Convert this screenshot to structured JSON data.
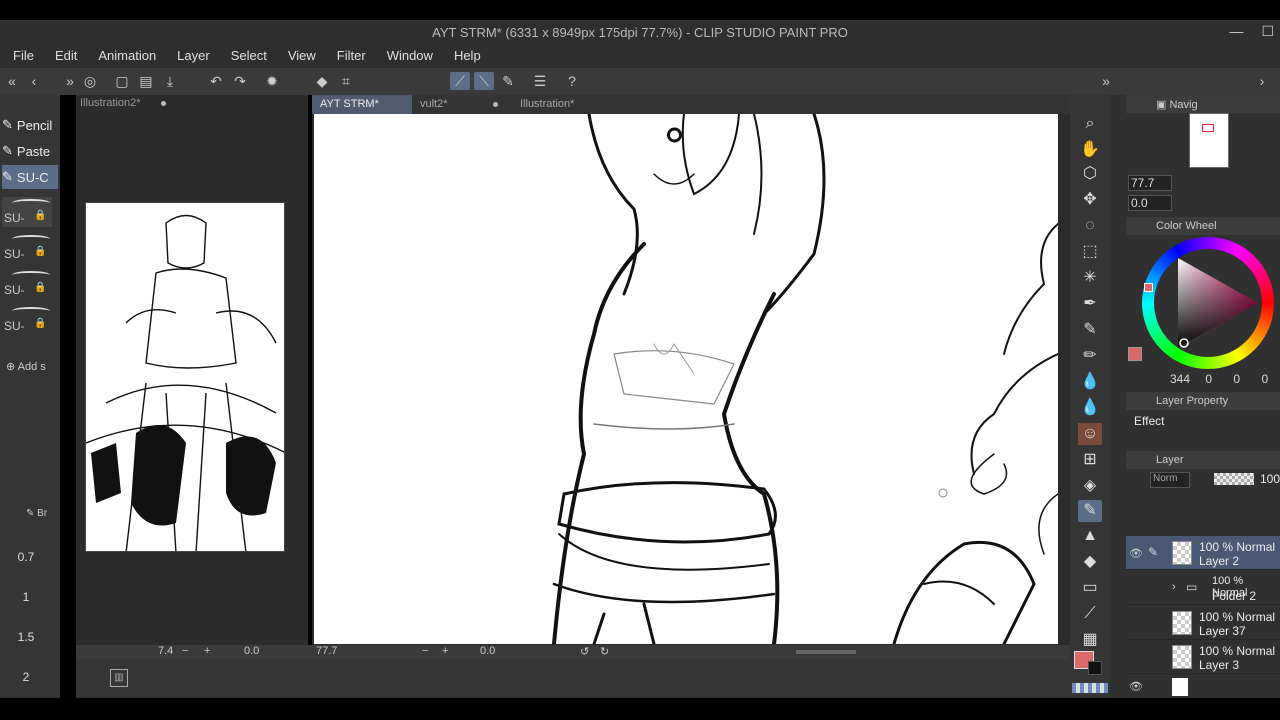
{
  "window": {
    "title": "AYT STRM* (6331 x 8949px 175dpi 77.7%) - CLIP STUDIO PAINT PRO",
    "minimize": "—",
    "maximize": "☐",
    "close": "✕"
  },
  "menu": [
    "File",
    "Edit",
    "Animation",
    "Layer",
    "Select",
    "View",
    "Filter",
    "Window",
    "Help"
  ],
  "subtools": [
    "Pencil",
    "Paste",
    "SU-C"
  ],
  "brushes": [
    "SU-",
    "SU-",
    "SU-",
    "SU-"
  ],
  "add_subtool": "Add s",
  "brush_size_label": "Br",
  "brush_sizes": [
    "0.7",
    "1",
    "1.5",
    "2"
  ],
  "nav_tab": "Illustration2*",
  "doc_tabs": [
    "AYT STRM*",
    "vult2*",
    "Illustration*"
  ],
  "status": {
    "nav_zoom": "7.4",
    "nav_rot": "0.0",
    "canvas_zoom": "77.7",
    "canvas_rot": "0.0"
  },
  "right": {
    "navigator_label": "Navig",
    "zoom": "77.7",
    "rotation": "0.0",
    "color_wheel_label": "Color Wheel",
    "color_value": "344",
    "color_s": "0",
    "color_v": "0",
    "color_extra": "0",
    "layer_property_label": "Layer Property",
    "effect_label": "Effect",
    "layer_label": "Layer",
    "blend_mode": "Norm",
    "opacity": "100",
    "main_color": "#d96a6a",
    "sub_color": "#111111"
  },
  "layers": [
    {
      "mode": "100 % Normal",
      "name": "Layer 2",
      "active": true
    },
    {
      "mode": "100 % Normal",
      "name": "Folder 2",
      "active": false
    },
    {
      "mode": "100 % Normal",
      "name": "Layer 37",
      "active": false
    },
    {
      "mode": "100 % Normal",
      "name": "Layer 3",
      "active": false
    }
  ]
}
